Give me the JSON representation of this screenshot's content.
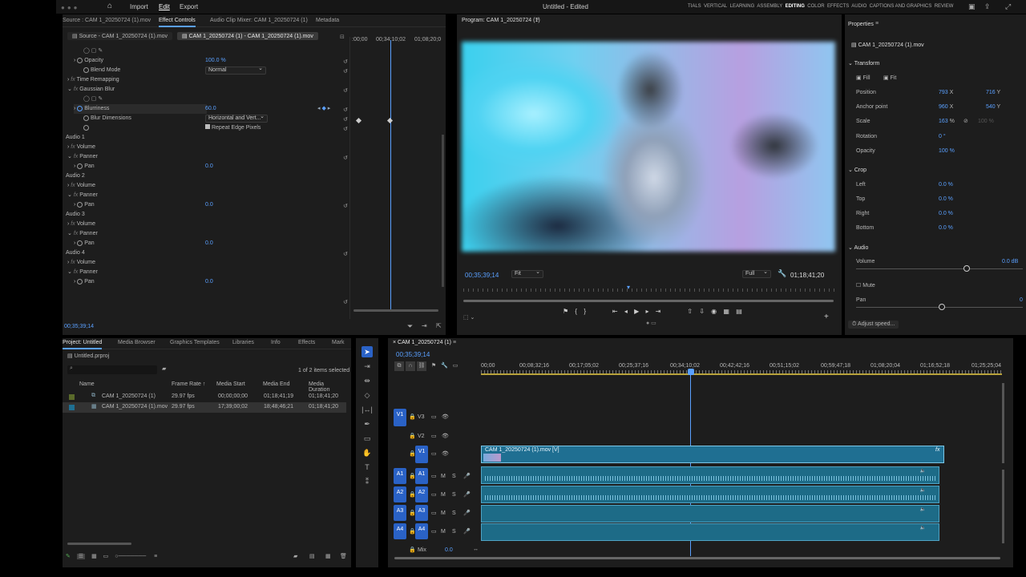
{
  "titlebar": {
    "nav": [
      "Import",
      "Edit",
      "Export"
    ],
    "title": "Untitled - Edited",
    "workspaces": [
      "TIALS",
      "VERTICAL",
      "LEARNING",
      "ASSEMBLY",
      "EDITING",
      "COLOR",
      "EFFECTS",
      "AUDIO",
      "CAPTIONS AND GRAPHICS",
      "REVIEW"
    ],
    "active_workspace": "EDITING"
  },
  "source_panel": {
    "tabs": [
      "Source : CAM 1_20250724 (1).mov",
      "Effect Controls",
      "Audio Clip Mixer: CAM 1_20250724 (1)",
      "Metadata"
    ],
    "subtabs": [
      "Source - CAM 1_20250724 (1).mov",
      "CAM 1_20250724 (1) - CAM 1_20250724 (1).mov"
    ],
    "timecodes": [
      ":00;00",
      "00;34;10;02",
      "01;08;20;0"
    ],
    "rows": {
      "opacity": "Opacity",
      "opacity_val": "100.0 %",
      "blend": "Blend Mode",
      "blend_val": "Normal",
      "time_remap": "Time Remapping",
      "gblur": "Gaussian Blur",
      "blurriness": "Blurriness",
      "blurriness_val": "60.0",
      "blurdim": "Blur Dimensions",
      "blurdim_val": "Horizontal and Vert...",
      "repeat": "Repeat Edge Pixels",
      "audio1": "Audio 1",
      "audio2": "Audio 2",
      "audio3": "Audio 3",
      "audio4": "Audio 4",
      "volume": "Volume",
      "panner": "Panner",
      "pan": "Pan",
      "pan_val": "0.0"
    },
    "footer_tc": "00;35;39;14"
  },
  "program": {
    "title": "Program: CAM 1_20250724 (1)",
    "tc_left": "00;35;39;14",
    "fit": "Fit",
    "quality": "Full",
    "tc_right": "01;18;41;20"
  },
  "properties": {
    "title": "Properties",
    "file": "CAM 1_20250724 (1).mov",
    "transform": "Transform",
    "fill": "Fill",
    "fit": "Fit",
    "position": "Position",
    "pos_x": "793",
    "pos_y": "716",
    "anchor": "Anchor point",
    "anc_x": "960",
    "anc_y": "540",
    "scale": "Scale",
    "scale_val": "163",
    "scale_pct": "%",
    "scale_val2": "100 %",
    "rotation": "Rotation",
    "rotation_val": "0 °",
    "opacity": "Opacity",
    "opacity_val": "100 %",
    "crop": "Crop",
    "left": "Left",
    "top": "Top",
    "right": "Right",
    "bottom": "Bottom",
    "crop_val": "0.0 %",
    "audio": "Audio",
    "volume": "Volume",
    "volume_val": "0.0 dB",
    "mute": "Mute",
    "pan": "Pan",
    "pan_val": "0",
    "adjust": "Adjust speed...",
    "x": "X",
    "y": "Y"
  },
  "project": {
    "tabs": [
      "Project: Untitled",
      "Media Browser",
      "Graphics Templates",
      "Libraries",
      "Info",
      "Effects",
      "Mark"
    ],
    "file": "Untitled.prproj",
    "count": "1 of 2 items selected",
    "columns": [
      "Name",
      "Frame Rate",
      "Media Start",
      "Media End",
      "Media Duration"
    ],
    "items": [
      {
        "name": "CAM 1_20250724 (1)",
        "fps": "29.97 fps",
        "start": "00;00;00;00",
        "end": "01;18;41;19",
        "dur": "01;18;41;20"
      },
      {
        "name": "CAM 1_20250724 (1).mov",
        "fps": "29.97 fps",
        "start": "17;39;00;02",
        "end": "18;48;46;21",
        "dur": "01;18;41;20"
      }
    ]
  },
  "timeline": {
    "tab": "CAM 1_20250724 (1)",
    "tc": "00;35;39;14",
    "ruler": [
      "00;00",
      "00;08;32;16",
      "00;17;05;02",
      "00;25;37;16",
      "00;34;10;02",
      "00;42;42;16",
      "00;51;15;02",
      "00;59;47;18",
      "01;08;20;04",
      "01;16;52;18",
      "01;25;25;04"
    ],
    "video_tracks": [
      "V3",
      "V2",
      "V1"
    ],
    "audio_tracks": [
      "A1",
      "A2",
      "A3",
      "A4"
    ],
    "clip_label": "CAM 1_20250724 (1).mov [V]",
    "mix": "Mix",
    "mix_val": "0.0",
    "m": "M",
    "s": "S",
    "fx": "fx"
  },
  "colors": {
    "accent": "#5aa0ff",
    "track_btn": "#2a62c6",
    "clip": "#1f6f92"
  }
}
